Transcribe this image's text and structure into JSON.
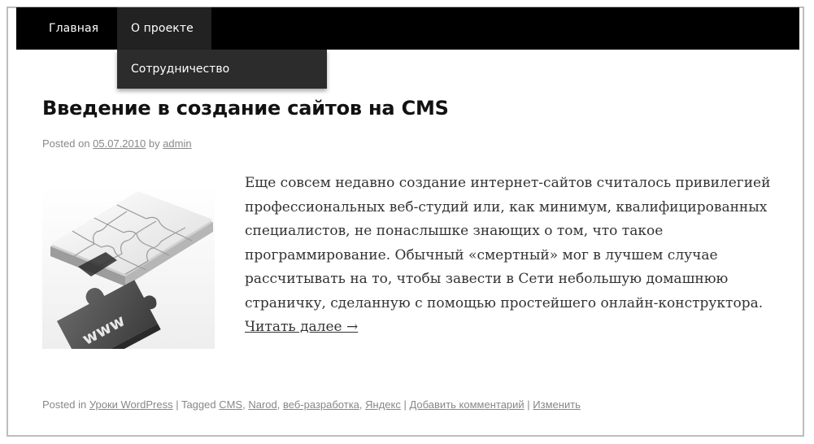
{
  "nav": {
    "items": [
      {
        "label": "Главная"
      },
      {
        "label": "О проекте",
        "active": true
      }
    ],
    "dropdown": [
      {
        "label": "Сотрудничество"
      }
    ]
  },
  "post": {
    "title": "Введение в создание сайтов на CMS",
    "meta": {
      "posted_on": "Posted on ",
      "date": "05.07.2010",
      "by": " by ",
      "author": "admin"
    },
    "image": {
      "label": "www",
      "icon": "puzzle-www-icon"
    },
    "body": "Еще совсем недавно создание интернет-сайтов считалось привилегией профессиональных веб-студий или, как минимум, квалифицированных специалистов, не понаслышке знающих о том, что такое программирование. Обычный «смертный» мог в лучшем случае рассчитывать на то, чтобы завести в Сети небольшую домашнюю страничку, сделанную с помощью простейшего онлайн-конструктора.",
    "read_more": "Читать далее →",
    "footer": {
      "posted_in": "Posted in ",
      "category": "Уроки WordPress",
      "sep1": " | ",
      "tagged": "Tagged ",
      "tags": [
        "CMS",
        "Narod",
        "веб-разработка",
        "Яндекс"
      ],
      "sep2": " | ",
      "comment": "Добавить комментарий",
      "sep3": " | ",
      "edit": "Изменить"
    }
  },
  "colors": {
    "nav_bg": "#000000",
    "dropdown_bg": "#2c2c2c",
    "meta_text": "#888888",
    "body_text": "#333333"
  }
}
